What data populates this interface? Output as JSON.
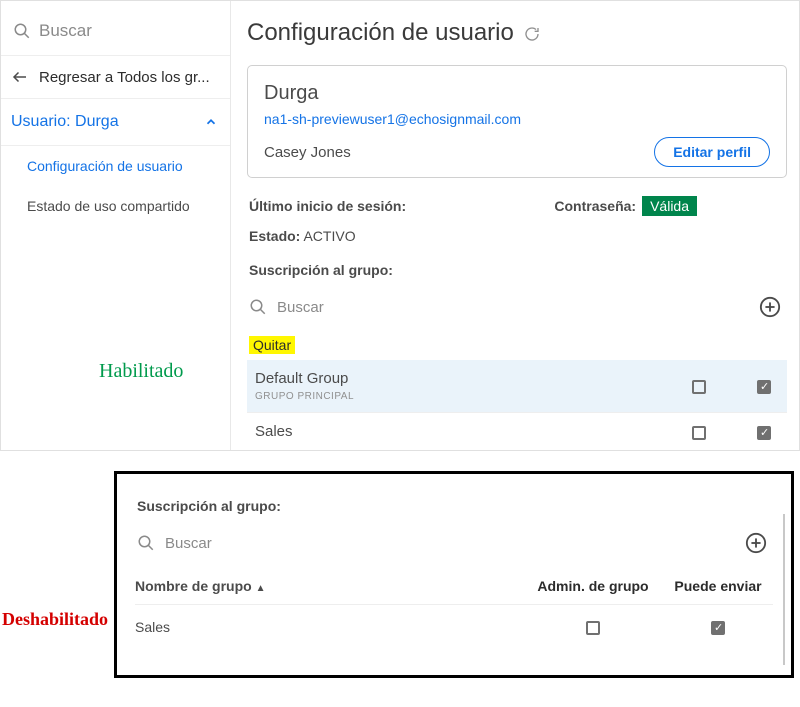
{
  "sidebar": {
    "search_placeholder": "Buscar",
    "back_label": "Regresar a Todos los gr...",
    "user_row": "Usuario: Durga",
    "items": [
      {
        "label": "Configuración de usuario"
      },
      {
        "label": "Estado de uso compartido"
      }
    ]
  },
  "page": {
    "title": "Configuración de usuario"
  },
  "profile": {
    "name": "Durga",
    "email": "na1-sh-previewuser1@echosignmail.com",
    "full_name": "Casey Jones",
    "edit_label": "Editar perfil"
  },
  "meta": {
    "last_login_label": "Último inicio de sesión:",
    "password_label": "Contraseña:",
    "password_badge": "Válida",
    "state_label": "Estado:",
    "state_value": "ACTIVO"
  },
  "groups_top": {
    "section_label": "Suscripción al grupo:",
    "search_placeholder": "Buscar",
    "quitar_label": "Quitar",
    "rows": [
      {
        "name": "Default Group",
        "sub": "GRUPO PRINCIPAL",
        "admin": false,
        "send": true,
        "highlight": true
      },
      {
        "name": "Sales",
        "sub": "",
        "admin": false,
        "send": true,
        "highlight": false
      }
    ]
  },
  "annotations": {
    "enabled": "Habilitado",
    "disabled": "Deshabilitado"
  },
  "groups_bottom": {
    "section_label": "Suscripción al grupo:",
    "search_placeholder": "Buscar",
    "columns": {
      "name": "Nombre de grupo",
      "admin": "Admin. de grupo",
      "send": "Puede enviar"
    },
    "rows": [
      {
        "name": "Sales",
        "admin": false,
        "send": true
      }
    ]
  }
}
